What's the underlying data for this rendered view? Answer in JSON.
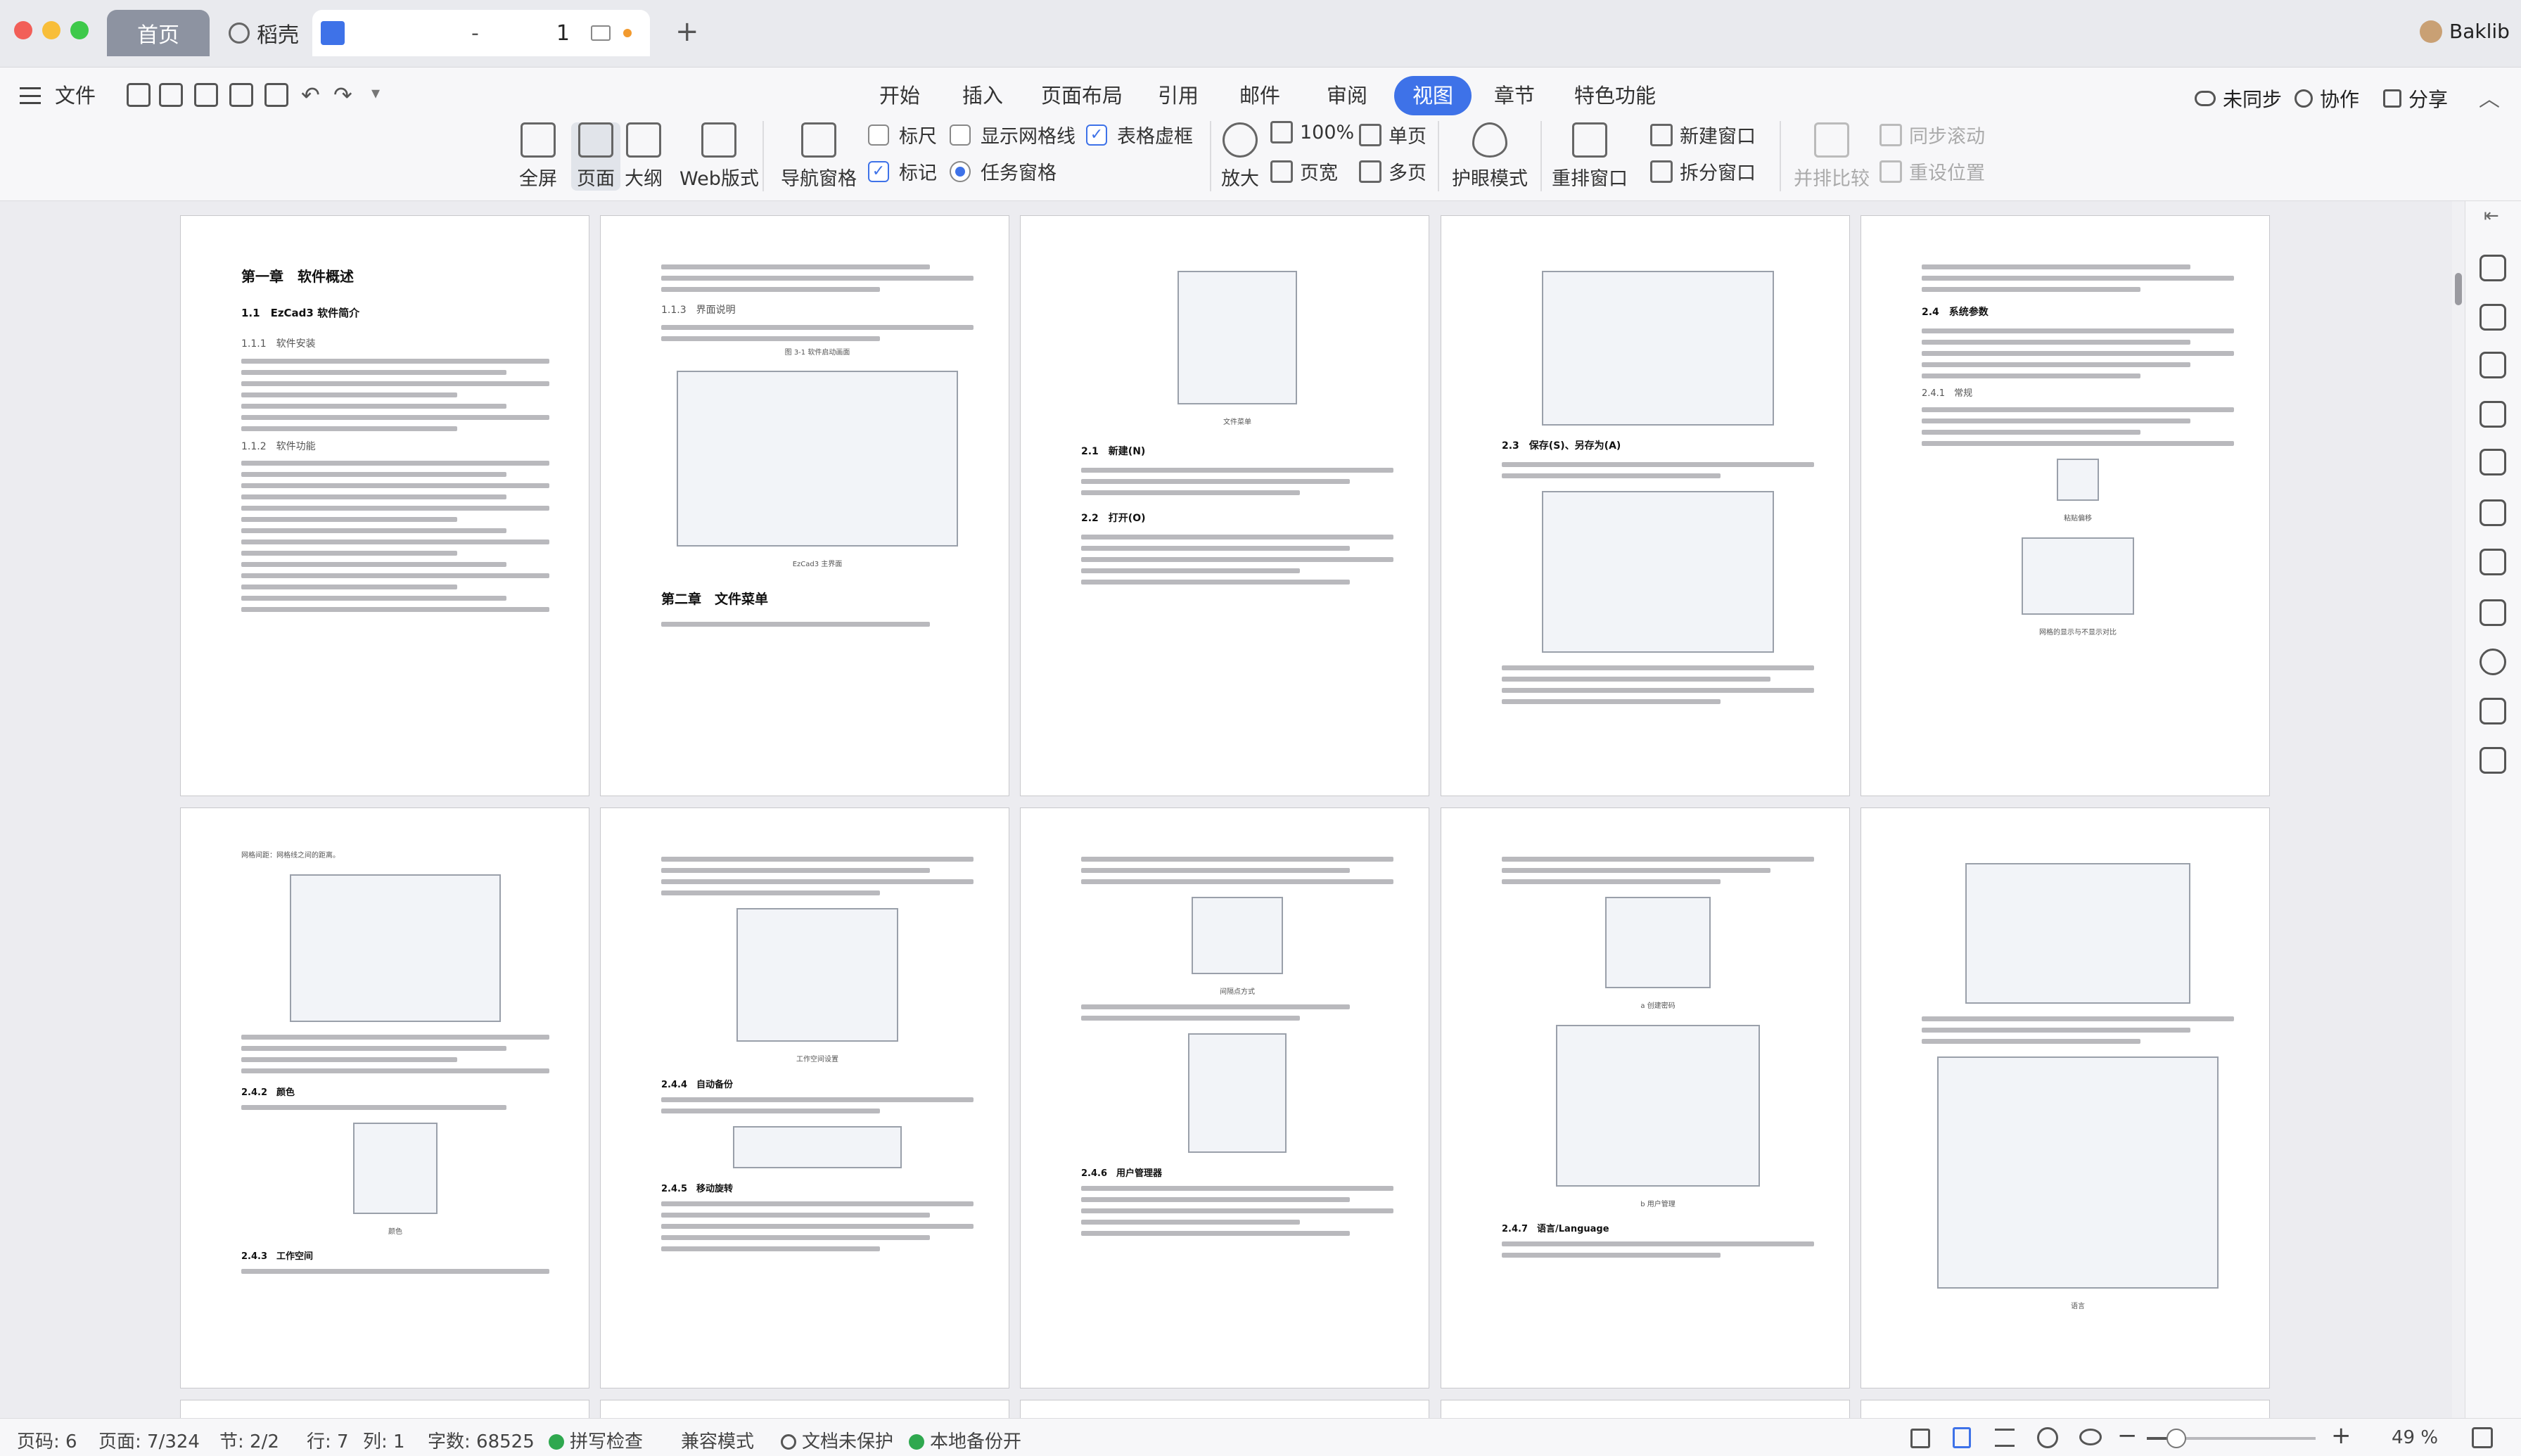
{
  "tabs": {
    "home": "首页",
    "docer": "稻壳",
    "doc_title": "-",
    "doc_page": "1",
    "add": "+"
  },
  "user": {
    "name": "Baklib"
  },
  "menu": {
    "file": "文件",
    "items": [
      "开始",
      "插入",
      "页面布局",
      "引用",
      "邮件",
      "审阅",
      "视图",
      "章节",
      "特色功能"
    ],
    "active": "视图",
    "sync": "未同步",
    "collab": "协作",
    "share": "分享"
  },
  "ribbon": {
    "fullscreen": "全屏",
    "page": "页面",
    "outline": "大纲",
    "web": "Web版式",
    "nav_pane": "导航窗格",
    "ruler": "标尺",
    "gridlines": "显示网格线",
    "table_frame": "表格虚框",
    "marker": "标记",
    "task_pane": "任务窗格",
    "zoom": "放大",
    "pct100": "100%",
    "page_width": "页宽",
    "single": "单页",
    "multi": "多页",
    "eye_care": "护眼模式",
    "rearrange": "重排窗口",
    "new_window": "新建窗口",
    "split_window": "拆分窗口",
    "side_by_side": "并排比较",
    "sync_scroll": "同步滚动",
    "reset_pos": "重设位置"
  },
  "pages": {
    "p1": {
      "ch": "第一章　软件概述",
      "s1": "1.1　EzCad3 软件简介",
      "s11": "1.1.1　软件安装",
      "s12": "1.1.2　软件功能"
    },
    "p2": {
      "s": "1.1.3　界面说明",
      "fig": "图 3-1 软件启动画面",
      "ch2": "第二章　文件菜单",
      "cap": "EzCad3 主界面"
    },
    "p3": {
      "s1": "2.1　新建(N)",
      "s2": "2.2　打开(O)",
      "cap": "文件菜单"
    },
    "p4": {
      "s": "2.3　保存(S)、另存为(A)"
    },
    "p5": {
      "s1": "2.4　系统参数",
      "s2": "2.4.1　常规",
      "cap": "粘贴偏移",
      "cap2": "网格的显示与不显示对比"
    },
    "p6": {
      "s1": "2.4.2　颜色",
      "s2": "2.4.3　工作空间",
      "lbl": "网格间距：网格线之间的距离。",
      "cap": "颜色"
    },
    "p7": {
      "s1": "2.4.4　自动备份",
      "s2": "2.4.5　移动旋转",
      "cap": "工作空间设置"
    },
    "p8": {
      "s": "2.4.6　用户管理器",
      "cap": "间隔点方式"
    },
    "p9": {
      "s": "2.4.7　语言/Language",
      "cap1": "a 创建密码",
      "cap2": "b 用户管理"
    },
    "p10": {
      "cap": "语言"
    }
  },
  "status": {
    "page_no": "页码: 6",
    "page": "页面: 7/324",
    "section": "节: 2/2",
    "row": "行: 7",
    "col": "列: 1",
    "words": "字数: 68525",
    "spell": "拼写检查",
    "compat": "兼容模式",
    "protect": "文档未保护",
    "backup": "本地备份开",
    "zoom": "49 %",
    "zoom_level": 0.49
  }
}
